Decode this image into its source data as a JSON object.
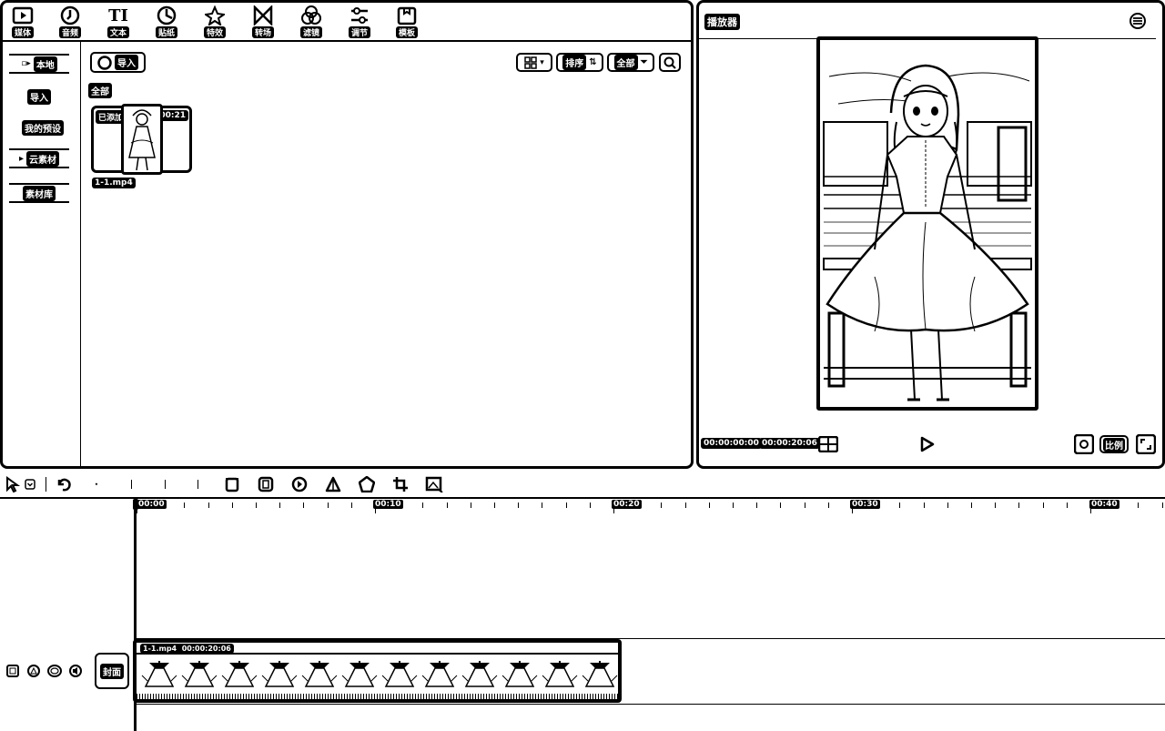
{
  "toolbar": {
    "tools": [
      {
        "label": "媒体",
        "icon": "media-icon"
      },
      {
        "label": "音频",
        "icon": "audio-icon"
      },
      {
        "label": "文本",
        "icon": "text-icon"
      },
      {
        "label": "贴纸",
        "icon": "sticker-icon"
      },
      {
        "label": "特效",
        "icon": "effects-icon"
      },
      {
        "label": "转场",
        "icon": "transition-icon"
      },
      {
        "label": "滤镜",
        "icon": "filter-icon"
      },
      {
        "label": "调节",
        "icon": "adjust-icon"
      },
      {
        "label": "模板",
        "icon": "template-icon"
      }
    ]
  },
  "sidebar": {
    "items": [
      {
        "label": "本地",
        "active": true
      },
      {
        "label": "导入"
      },
      {
        "label": "我的预设"
      },
      {
        "label": "云素材"
      },
      {
        "label": "素材库"
      }
    ]
  },
  "media": {
    "import_label": "导入",
    "sort_label": "排序",
    "all_filter_label": "全部",
    "section_label": "全部",
    "clip": {
      "added_badge": "已添加",
      "duration": "00:21",
      "filename": "1-1.mp4"
    }
  },
  "player": {
    "title": "播放器",
    "current_time": "00:00:00:00",
    "total_time": "00:00:20:06",
    "ratio_label": "比例"
  },
  "timeline": {
    "ruler_labels": [
      "00:00",
      "00:10",
      "00:20",
      "00:30",
      "00:40"
    ],
    "cover_label": "封面",
    "clip_label": "1-1.mp4  00:00:20:06"
  }
}
